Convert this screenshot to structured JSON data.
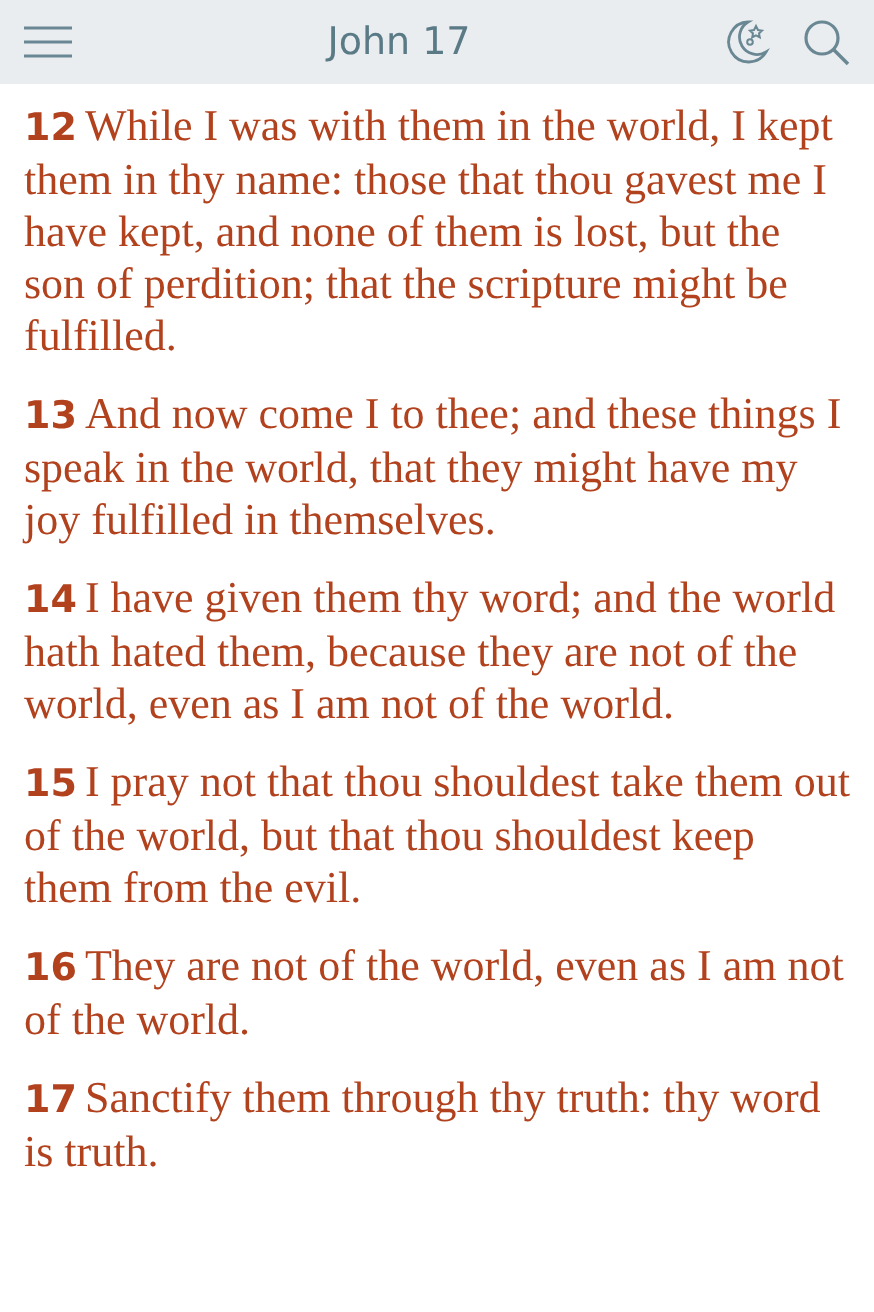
{
  "header": {
    "title": "John 17"
  },
  "verses": [
    {
      "number": "12",
      "text": "While I was with them in the world, I kept them in thy name: those that thou gavest me I have kept, and none of them is lost, but the son of perdition; that the scripture might be fulfilled."
    },
    {
      "number": "13",
      "text": "And now come I to thee; and these things I speak in the world, that they might have my joy fulfilled in themselves."
    },
    {
      "number": "14",
      "text": "I have given them thy word; and the world hath hated them, because they are not of the world, even as I am not of the world."
    },
    {
      "number": "15",
      "text": "I pray not that thou shouldest take them out of the world, but that thou shouldest keep them from the evil."
    },
    {
      "number": "16",
      "text": "They are not of the world, even as I am not of the world."
    },
    {
      "number": "17",
      "text": "Sanctify them through thy truth: thy word is truth."
    }
  ]
}
